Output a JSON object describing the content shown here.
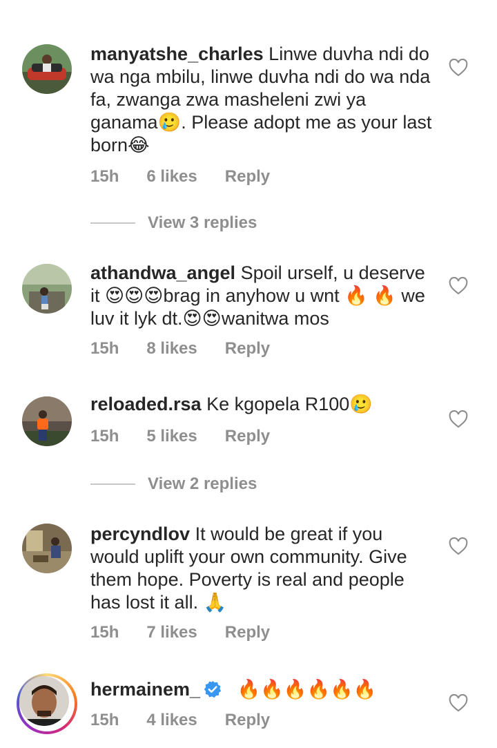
{
  "comments": [
    {
      "username": "manyatshe_charles",
      "text": "Linwe duvha ndi do wa nga mbilu, linwe duvha ndi do wa nda fa, zwanga zwa masheleni zwi ya ganama🥲. Please adopt me as your last born😂",
      "time": "15h",
      "likes": "6 likes",
      "reply": "Reply",
      "view_replies": "View 3 replies"
    },
    {
      "username": "athandwa_angel",
      "text": "Spoil urself, u deserve it 😍😍😍brag in anyhow u wnt 🔥 🔥 we luv it lyk dt.😍😍wanitwa mos",
      "time": "15h",
      "likes": "8 likes",
      "reply": "Reply"
    },
    {
      "username": "reloaded.rsa",
      "text": "Ke kgopela R100🥲",
      "time": "15h",
      "likes": "5 likes",
      "reply": "Reply",
      "view_replies": "View 2 replies"
    },
    {
      "username": "percyndlov",
      "text": "It would be great if you would uplift your own community. Give them hope. Poverty is real and people has lost it all. 🙏",
      "time": "15h",
      "likes": "7 likes",
      "reply": "Reply"
    },
    {
      "username": "hermainem_",
      "text": "🔥🔥🔥🔥🔥🔥",
      "time": "15h",
      "likes": "4 likes",
      "reply": "Reply",
      "verified": true
    }
  ],
  "colors": {
    "text": "#262626",
    "meta": "#8e8e8e",
    "verified": "#3897f0"
  },
  "icons": {
    "like": "heart-outline-icon",
    "verified": "verified-badge-icon"
  }
}
